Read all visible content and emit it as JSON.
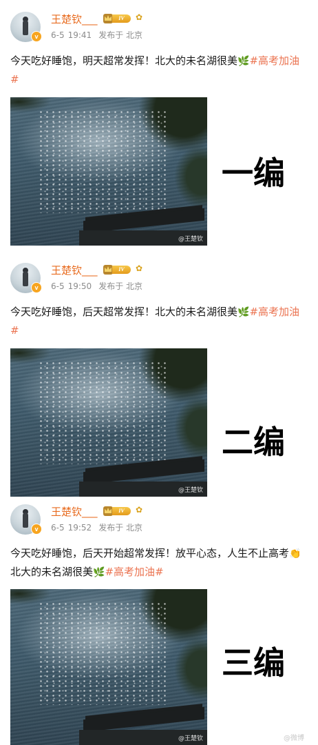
{
  "posts": [
    {
      "username": "王楚钦___",
      "level": "IV",
      "date": "6-5",
      "time": "19:41",
      "source": "发布于 北京",
      "text_before": "今天吃好睡饱，明天超常发挥！北大的未名湖很美",
      "emoji1": "leaf-emoji",
      "hashtag": "#高考加油#",
      "photo_watermark": "@王楚钦",
      "edit_label": "一编"
    },
    {
      "username": "王楚钦___",
      "level": "IV",
      "date": "6-5",
      "time": "19:50",
      "source": "发布于 北京",
      "text_before": "今天吃好睡饱，后天超常发挥！北大的未名湖很美",
      "emoji1": "leaf-emoji",
      "hashtag": "#高考加油#",
      "photo_watermark": "@王楚钦",
      "edit_label": "二编"
    },
    {
      "username": "王楚钦___",
      "level": "IV",
      "date": "6-5",
      "time": "19:52",
      "source": "发布于 北京",
      "text_before": "今天吃好睡饱，后天开始超常发挥！放平心态，人生不止高考",
      "text_middle": "北大的未名湖很美",
      "emoji1": "clap-emoji",
      "emoji2": "leaf-emoji",
      "hashtag": "#高考加油#",
      "photo_watermark": "@王楚钦",
      "edit_label": "三编"
    }
  ],
  "verified_badge": "v",
  "page_watermark": "@微博"
}
